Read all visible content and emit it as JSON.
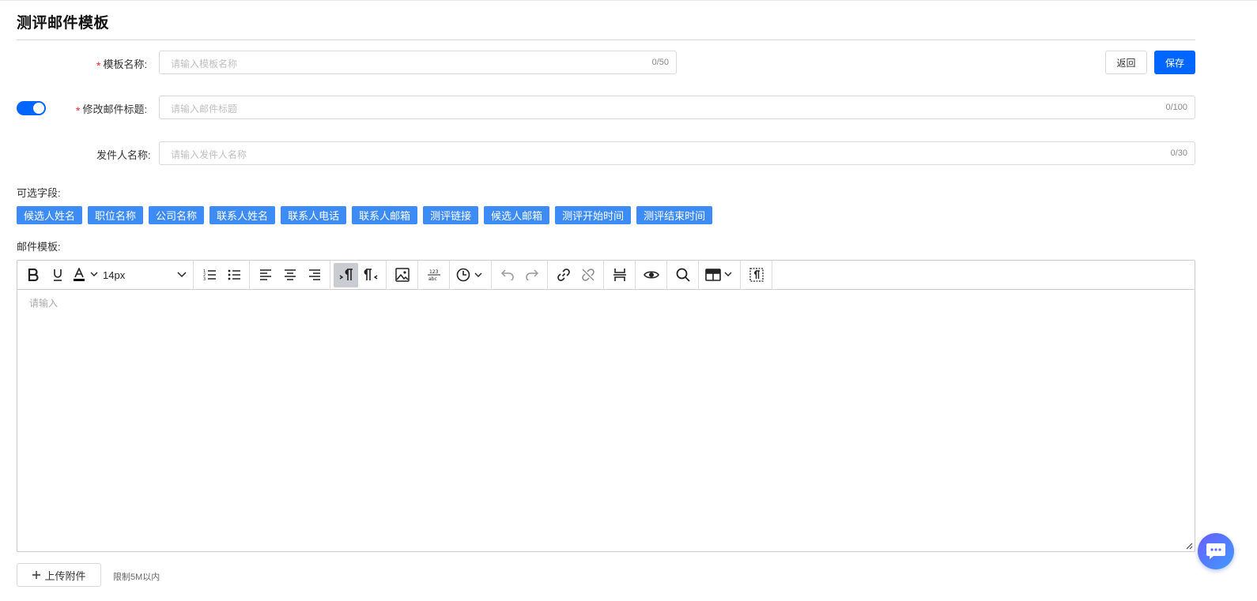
{
  "page": {
    "title": "测评邮件模板"
  },
  "form": {
    "template_name": {
      "label": "模板名称:",
      "required": true,
      "placeholder": "请输入模板名称",
      "counter": "0/50"
    },
    "subject": {
      "label": "修改邮件标题:",
      "required": true,
      "toggle_on": true,
      "placeholder": "请输入邮件标题",
      "counter": "0/100"
    },
    "sender": {
      "label": "发件人名称:",
      "placeholder": "请输入发件人名称",
      "counter": "0/30"
    }
  },
  "actions": {
    "back_label": "返回",
    "save_label": "保存"
  },
  "fields": {
    "label": "可选字段:",
    "tags": [
      "候选人姓名",
      "职位名称",
      "公司名称",
      "联系人姓名",
      "联系人电话",
      "联系人邮箱",
      "测评链接",
      "候选人邮箱",
      "测评开始时间",
      "测评结束时间"
    ]
  },
  "template": {
    "label": "邮件模板:",
    "font_size": "14px",
    "placeholder": "请输入"
  },
  "upload": {
    "button_label": "上传附件",
    "hint": "限制5M以内"
  },
  "colors": {
    "primary": "#0066ff",
    "tag": "#3d8bf5",
    "required": "#f5222d"
  },
  "icons": [
    "bold-icon",
    "underline-icon",
    "font-color-icon",
    "ordered-list-icon",
    "bullet-list-icon",
    "align-left-icon",
    "align-center-icon",
    "align-right-icon",
    "ltr-icon",
    "rtl-icon",
    "image-icon",
    "spellcheck-icon",
    "clock-icon",
    "undo-icon",
    "redo-icon",
    "link-icon",
    "unlink-icon",
    "page-break-icon",
    "preview-icon",
    "search-icon",
    "table-icon",
    "show-blocks-icon",
    "chat-icon"
  ]
}
